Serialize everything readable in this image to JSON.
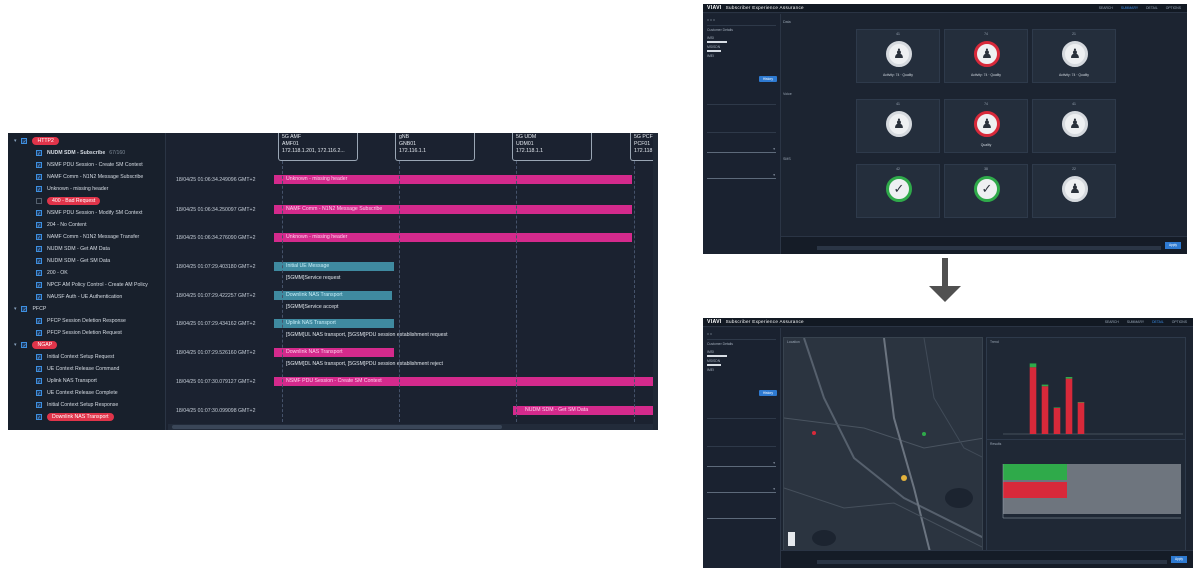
{
  "tree": {
    "rows": [
      {
        "kind": "group",
        "caret": "▾",
        "label": "HTTP2",
        "pill": true,
        "checked": true
      },
      {
        "kind": "item",
        "label": "NUDM SDM - Subscribe",
        "bold": true,
        "extra": "67/160"
      },
      {
        "kind": "item",
        "label": "NSMF PDU Session - Create SM Context"
      },
      {
        "kind": "item",
        "label": "NAMF Comm - N1N2 Message Subscribe"
      },
      {
        "kind": "item",
        "label": "Unknown - missing header"
      },
      {
        "kind": "item",
        "label": "400 - Bad Request",
        "pill": true,
        "checked": false
      },
      {
        "kind": "item",
        "label": "NSMF PDU Session - Modify SM Context"
      },
      {
        "kind": "item",
        "label": "204 - No Content"
      },
      {
        "kind": "item",
        "label": "NAMF Comm - N1N2 Message Transfer"
      },
      {
        "kind": "item",
        "label": "NUDM SDM - Get AM Data"
      },
      {
        "kind": "item",
        "label": "NUDM SDM - Get SM Data"
      },
      {
        "kind": "item",
        "label": "200 - OK"
      },
      {
        "kind": "item",
        "label": "NPCF AM Policy Control - Create AM Policy"
      },
      {
        "kind": "item",
        "label": "NAUSF Auth - UE Authentication"
      },
      {
        "kind": "group",
        "caret": "▾",
        "label": "PFCP",
        "pill": false,
        "checked": true
      },
      {
        "kind": "item",
        "label": "PFCP Session Deletion Response"
      },
      {
        "kind": "item",
        "label": "PFCP Session Deletion Request"
      },
      {
        "kind": "group",
        "caret": "▾",
        "label": "NGAP",
        "pill": true,
        "checked": true
      },
      {
        "kind": "item",
        "label": "Initial Context Setup Request"
      },
      {
        "kind": "item",
        "label": "UE Context Release Command"
      },
      {
        "kind": "item",
        "label": "Uplink NAS Transport"
      },
      {
        "kind": "item",
        "label": "UE Context Release Complete"
      },
      {
        "kind": "item",
        "label": "Initial Context Setup Response"
      },
      {
        "kind": "item",
        "label": "Downlink NAS Transport",
        "pill": true
      }
    ]
  },
  "lanes": [
    {
      "name": "5G AMF",
      "id": "AMF01",
      "ip": "172.118.1.201, 172.116.2..."
    },
    {
      "name": "gNB",
      "id": "GNB01",
      "ip": "172.116.1.1"
    },
    {
      "name": "5G UDM",
      "id": "UDM01",
      "ip": "172.118.1.1"
    },
    {
      "name": "5G PCF",
      "id": "PCF01",
      "ip": "172.118"
    }
  ],
  "messages": [
    {
      "time": "18/04/25 01:06:34.249096 GMT+2",
      "label": "Unknown - missing header",
      "color": "pink",
      "sub": ""
    },
    {
      "time": "18/04/25 01:06:34.250097 GMT+2",
      "label": "NAMF Comm - N1N2 Message Subscribe",
      "color": "pink",
      "sub": ""
    },
    {
      "time": "18/04/25 01:06:34.276090 GMT+2",
      "label": "Unknown - missing header",
      "color": "pink",
      "sub": ""
    },
    {
      "time": "18/04/25 01:07:29.403180 GMT+2",
      "label": "Initial UE Message",
      "color": "teal",
      "sub": "[5GMM]Service request"
    },
    {
      "time": "18/04/25 01:07:29.422257 GMT+2",
      "label": "Downlink NAS Transport",
      "color": "teal",
      "sub": "[5GMM]Service accept"
    },
    {
      "time": "18/04/25 01:07:29.434162 GMT+2",
      "label": "Uplink NAS Transport",
      "color": "teal",
      "sub": "[5GMM]UL NAS transport, [5GSM]PDU session establishment request"
    },
    {
      "time": "18/04/25 01:07:29.526160 GMT+2",
      "label": "Downlink NAS Transport",
      "color": "pink",
      "sub": "[5GMM]DL NAS transport, [5GSM]PDU session establishment reject"
    },
    {
      "time": "18/04/25 01:07:30.079127 GMT+2",
      "label": "NSMF PDU Session - Create SM Context",
      "color": "pink",
      "sub": ""
    },
    {
      "time": "18/04/25 01:07:30.099098 GMT+2",
      "label": "NUDM SDM - Get SM Data",
      "color": "pink",
      "sub": ""
    }
  ],
  "app": {
    "brand": "VIAVI",
    "title": "Subscriber Experience Assurance",
    "nav": [
      "SEARCH",
      "SUMMARY",
      "DETAIL",
      "OPTIONS"
    ],
    "apply": "Apply",
    "history": "History"
  },
  "top_win": {
    "active_nav": "SUMMARY",
    "sections": [
      "Data",
      "Voice",
      "SMS"
    ],
    "cards": [
      {
        "count": "41",
        "state": "neutral",
        "caption": "Activity: 74 · Quality"
      },
      {
        "count": "74",
        "state": "red",
        "caption": "Activity: 74 · Quality"
      },
      {
        "count": "21",
        "state": "neutral",
        "caption": "Activity: 74 · Quality"
      },
      {
        "count": "41",
        "state": "neutral",
        "caption": ""
      },
      {
        "count": "74",
        "state": "red",
        "caption": "Quality"
      },
      {
        "count": "41",
        "state": "neutral",
        "caption": ""
      },
      {
        "count": "42",
        "state": "green",
        "caption": ""
      },
      {
        "count": "38",
        "state": "green",
        "caption": ""
      },
      {
        "count": "22",
        "state": "neutral",
        "caption": ""
      }
    ]
  },
  "bottom_win": {
    "active_nav": "DETAIL",
    "panels": [
      "Location",
      "Trend",
      "Results"
    ],
    "legend": [
      "Calls with bad result",
      "Calls failed result"
    ],
    "legend2": [
      "Busy",
      "Failures",
      "Success"
    ]
  },
  "chart_data": {
    "type": "bar",
    "categories": [
      "1",
      "2",
      "3",
      "4",
      "5",
      "6",
      "7",
      "8",
      "9",
      "10",
      "11",
      "12",
      "13",
      "14",
      "15"
    ],
    "series": [
      {
        "name": "Calls with bad result",
        "values": [
          0,
          0,
          7,
          3,
          1,
          3,
          1,
          0,
          0,
          0,
          0,
          0,
          0,
          0,
          0
        ],
        "color": "#2faa4a"
      },
      {
        "name": "Calls failed result",
        "values": [
          0,
          0,
          123,
          88,
          48,
          102,
          58,
          0,
          0,
          0,
          0,
          0,
          0,
          0,
          0
        ],
        "color": "#d8293a"
      }
    ],
    "ylim": [
      0,
      140
    ]
  },
  "colors": {
    "pink": "#d42a8c",
    "teal": "#3f8aa0",
    "accent": "#3b8ee8",
    "red": "#d8293a",
    "green": "#2faa4a"
  }
}
